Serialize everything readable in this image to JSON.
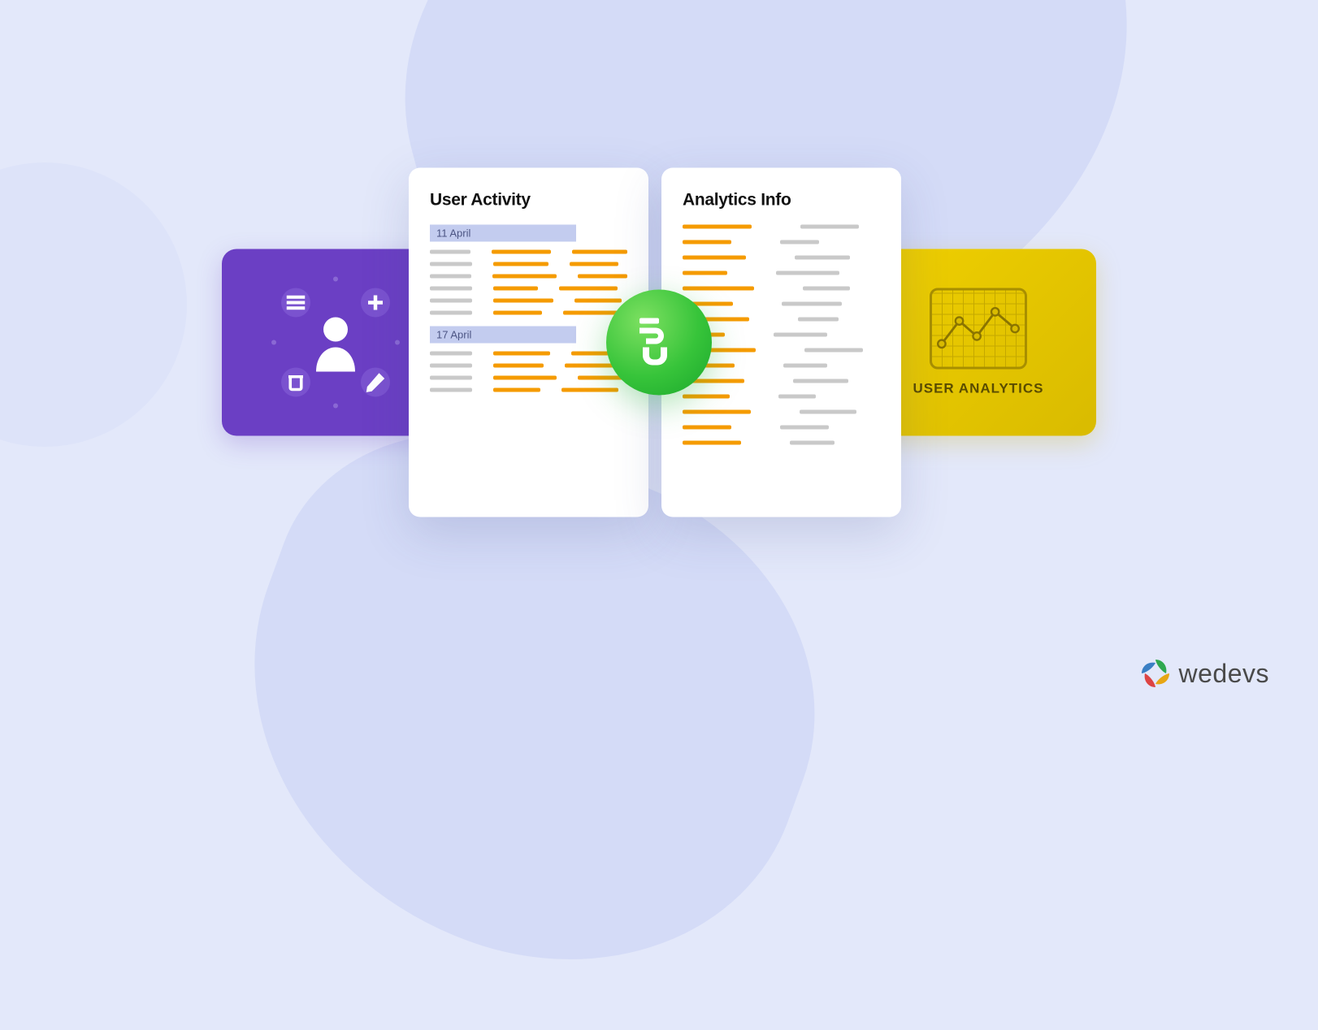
{
  "cards": {
    "user_activity": {
      "title": "User Activity",
      "groups": [
        {
          "date": "11 April"
        },
        {
          "date": "17 April"
        }
      ]
    },
    "analytics_info": {
      "title": "Analytics Info"
    },
    "user_analytics_panel": {
      "label": "USER ANALYTICS"
    }
  },
  "brand": {
    "name": "wedevs"
  }
}
